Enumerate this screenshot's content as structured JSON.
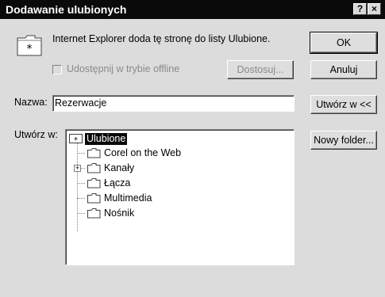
{
  "window": {
    "title": "Dodawanie ulubionych",
    "help_label": "?",
    "close_label": "×"
  },
  "info": {
    "message": "Internet Explorer doda tę stronę do listy Ulubione.",
    "offline_checkbox_label": "Udostępnij w trybie offline",
    "offline_checked": false
  },
  "buttons": {
    "ok": "OK",
    "cancel": "Anuluj",
    "customize": "Dostosuj...",
    "create_in": "Utwórz w <<",
    "new_folder": "Nowy folder..."
  },
  "name_field": {
    "label": "Nazwa:",
    "value": "Rezerwacje"
  },
  "create_in": {
    "label": "Utwórz w:",
    "tree": [
      {
        "label": "Ulubione",
        "selected": true,
        "icon": "favorites-star-icon"
      },
      {
        "label": "Corel on the Web",
        "icon": "folder-icon"
      },
      {
        "label": "Kanały",
        "icon": "folder-icon",
        "expandable": true,
        "expander": "+"
      },
      {
        "label": "Łącza",
        "icon": "folder-icon"
      },
      {
        "label": "Multimedia",
        "icon": "folder-icon"
      },
      {
        "label": "Nośnik",
        "icon": "folder-icon"
      }
    ]
  }
}
